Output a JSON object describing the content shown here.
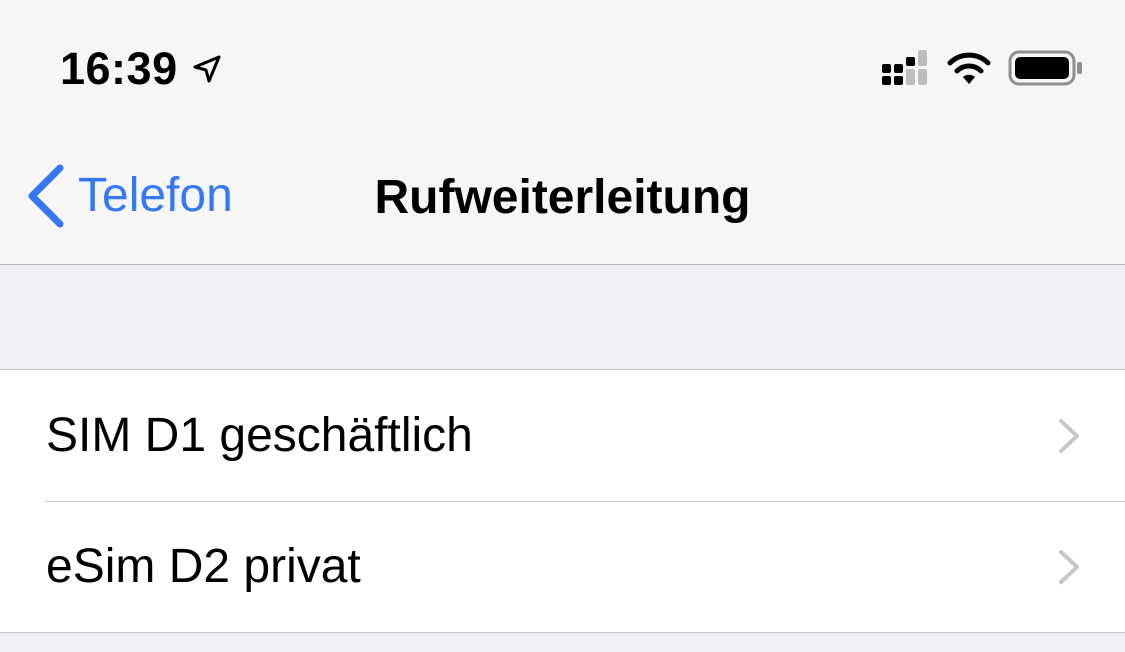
{
  "status_bar": {
    "time": "16:39",
    "icons": [
      "location-arrow-icon",
      "cellular-signal-icon",
      "wifi-icon",
      "battery-icon"
    ]
  },
  "nav_bar": {
    "back_label": "Telefon",
    "title": "Rufweiterleitung"
  },
  "list": {
    "items": [
      {
        "label": "SIM D1 geschäftlich"
      },
      {
        "label": "eSim D2 privat"
      }
    ]
  },
  "colors": {
    "accent": "#3478f6",
    "background": "#efeff4",
    "bar": "#f6f6f6",
    "separator": "#c8c7cc",
    "chevron": "#c7c7cc"
  }
}
